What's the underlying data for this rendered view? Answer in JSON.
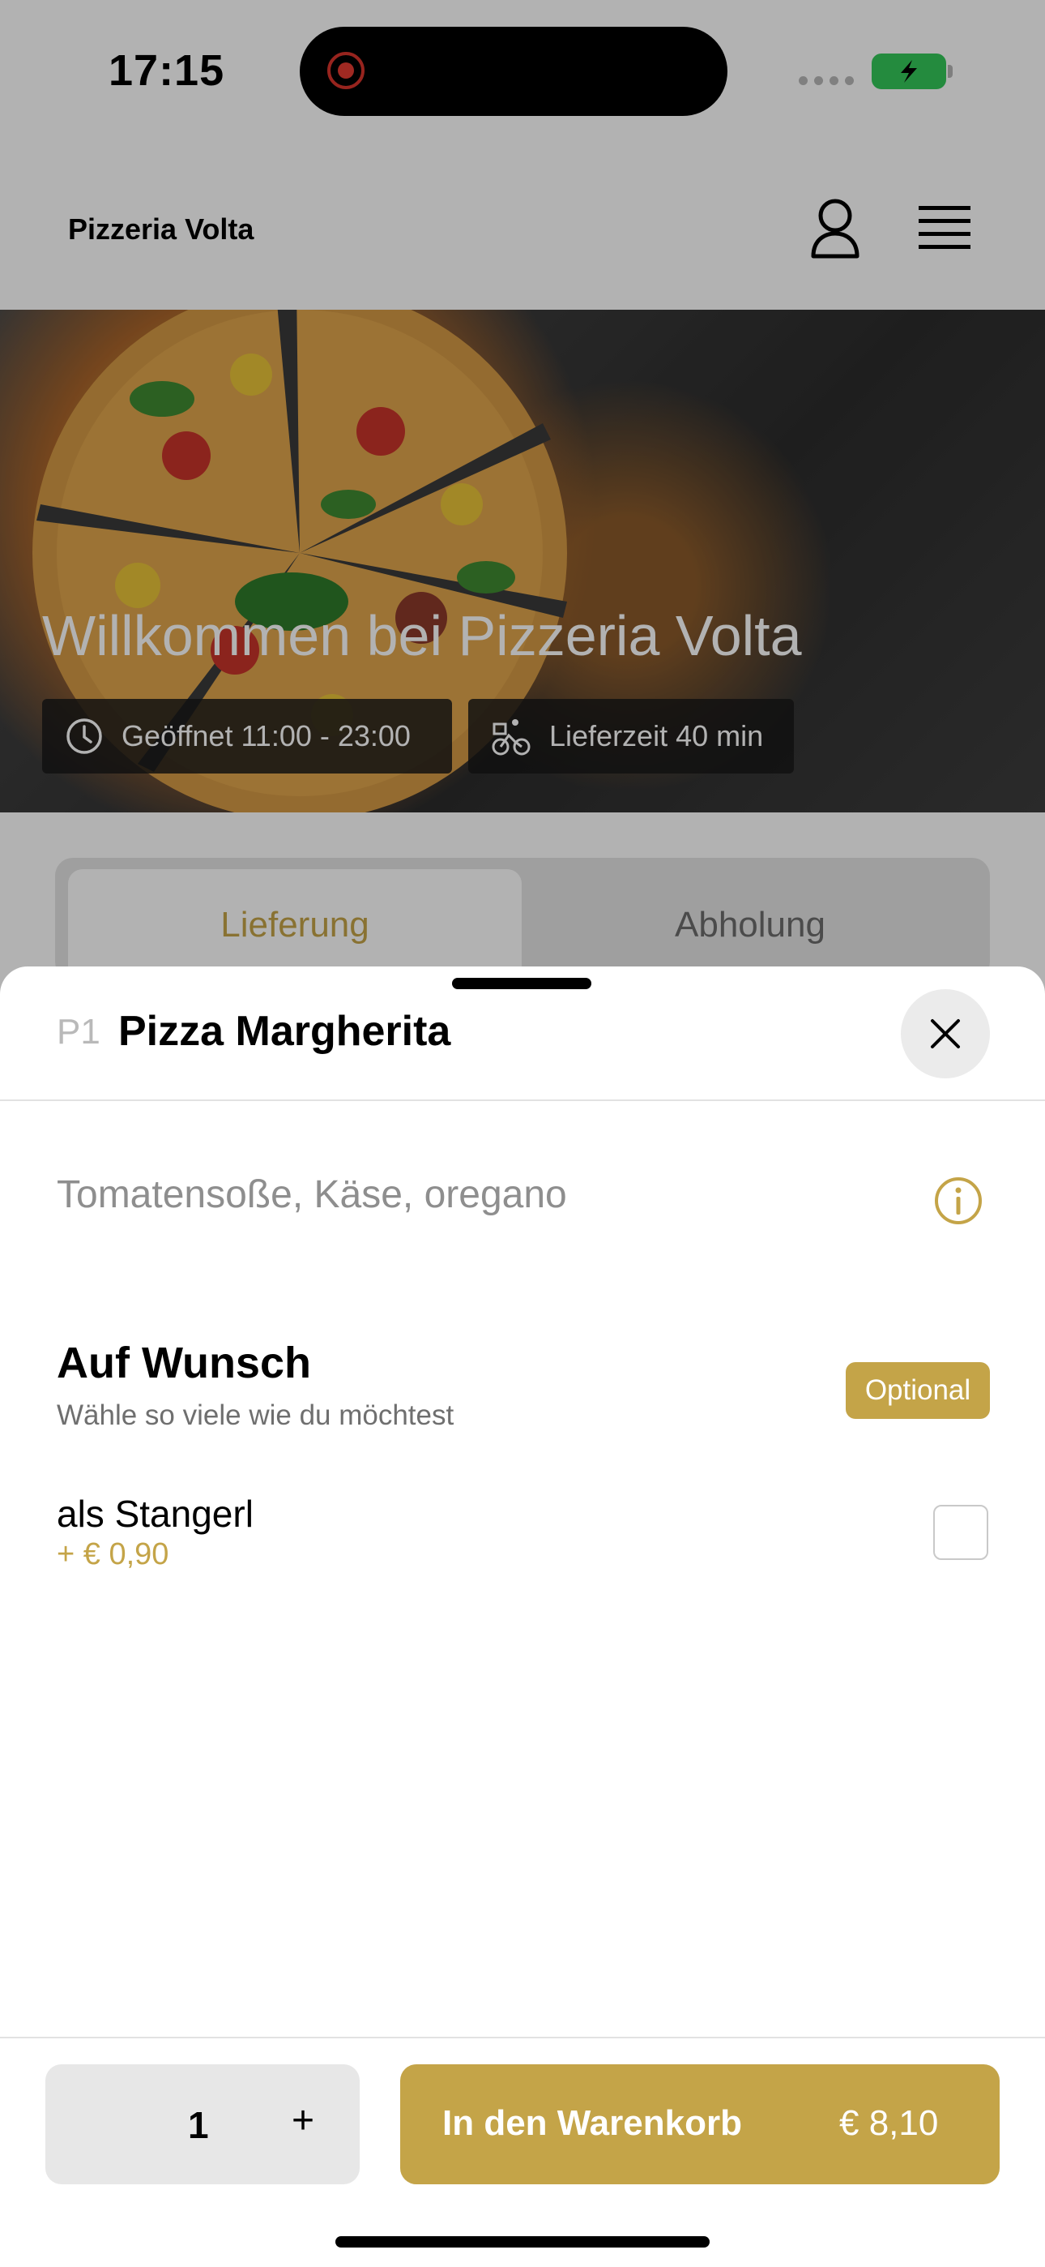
{
  "status_bar": {
    "time": "17:15"
  },
  "header": {
    "brand": "Pizzeria Volta"
  },
  "hero": {
    "welcome": "Willkommen bei Pizzeria Volta",
    "opening_hours": "Geöffnet 11:00 - 23:00",
    "delivery_time": "Lieferzeit 40 min"
  },
  "tabs": [
    {
      "label": "Lieferung",
      "active": true
    },
    {
      "label": "Abholung",
      "active": false
    }
  ],
  "sheet": {
    "product_number": "P1",
    "product_name": "Pizza Margherita",
    "description": "Tomatensoße, Käse, oregano",
    "section": {
      "title": "Auf Wunsch",
      "subtitle": "Wähle so viele wie du möchtest",
      "badge": "Optional"
    },
    "option": {
      "label": "als Stangerl",
      "price": "+ € 0,90",
      "checked": false
    }
  },
  "footer": {
    "quantity": "1",
    "plus": "+",
    "cart_label": "In den Warenkorb",
    "cart_price": "€ 8,10"
  },
  "colors": {
    "accent": "#c4a448",
    "dim_overlay": "rgba(0,0,0,0.30)"
  }
}
